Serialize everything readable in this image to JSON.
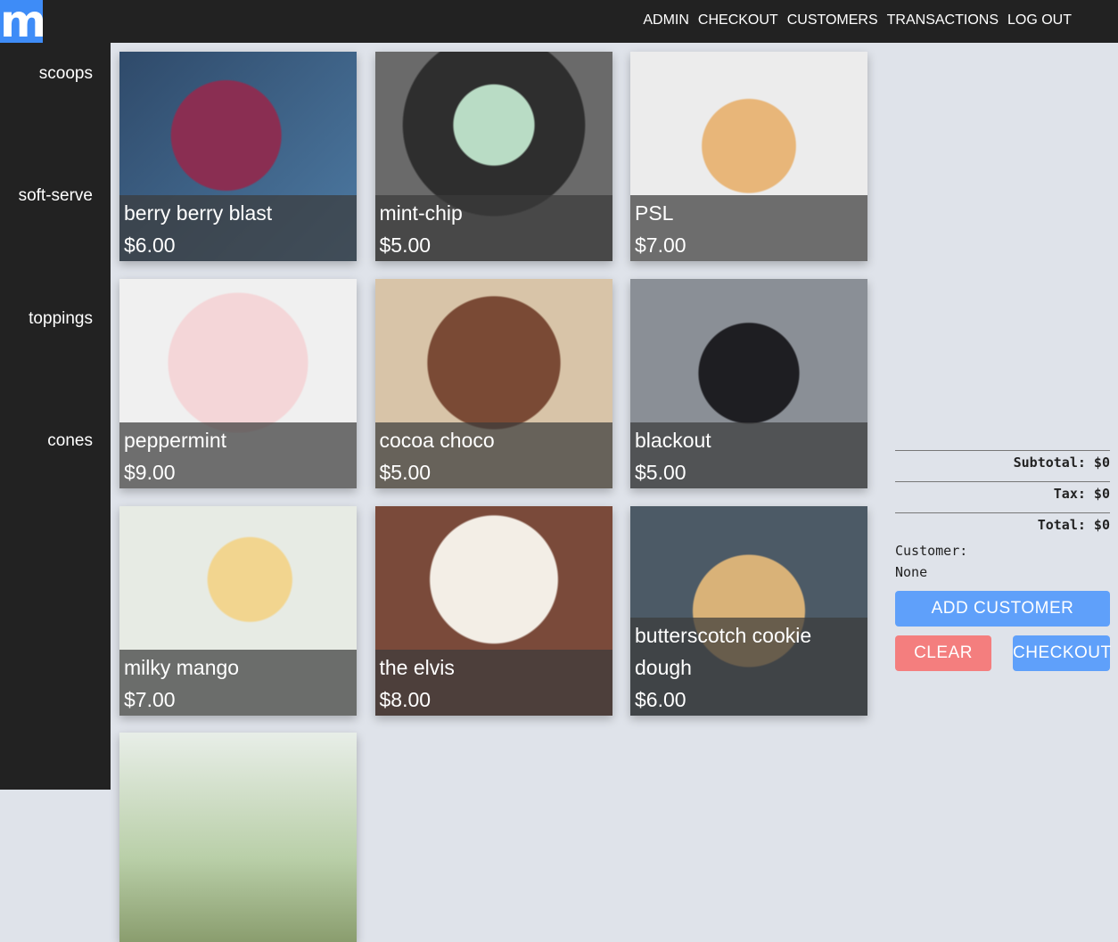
{
  "logo": "m",
  "nav": [
    "ADMIN",
    "CHECKOUT",
    "CUSTOMERS",
    "TRANSACTIONS",
    "LOG OUT"
  ],
  "sidebar": [
    "scoops",
    "soft-serve",
    "toppings",
    "cones"
  ],
  "products": [
    {
      "name": "berry berry blast",
      "price": "$6.00"
    },
    {
      "name": "mint-chip",
      "price": "$5.00"
    },
    {
      "name": "PSL",
      "price": "$7.00"
    },
    {
      "name": "peppermint",
      "price": "$9.00"
    },
    {
      "name": "cocoa choco",
      "price": "$5.00"
    },
    {
      "name": "blackout",
      "price": "$5.00"
    },
    {
      "name": "milky mango",
      "price": "$7.00"
    },
    {
      "name": "the elvis",
      "price": "$8.00"
    },
    {
      "name": "butterscotch cookie dough",
      "price": "$6.00"
    }
  ],
  "cart": {
    "subtotal": "Subtotal: $0",
    "tax": "Tax: $0",
    "total": "Total: $0",
    "customer_label": "Customer:",
    "customer_value": "None"
  },
  "buttons": {
    "add_customer": "ADD CUSTOMER",
    "clear": "CLEAR",
    "checkout": "CHECKOUT"
  }
}
